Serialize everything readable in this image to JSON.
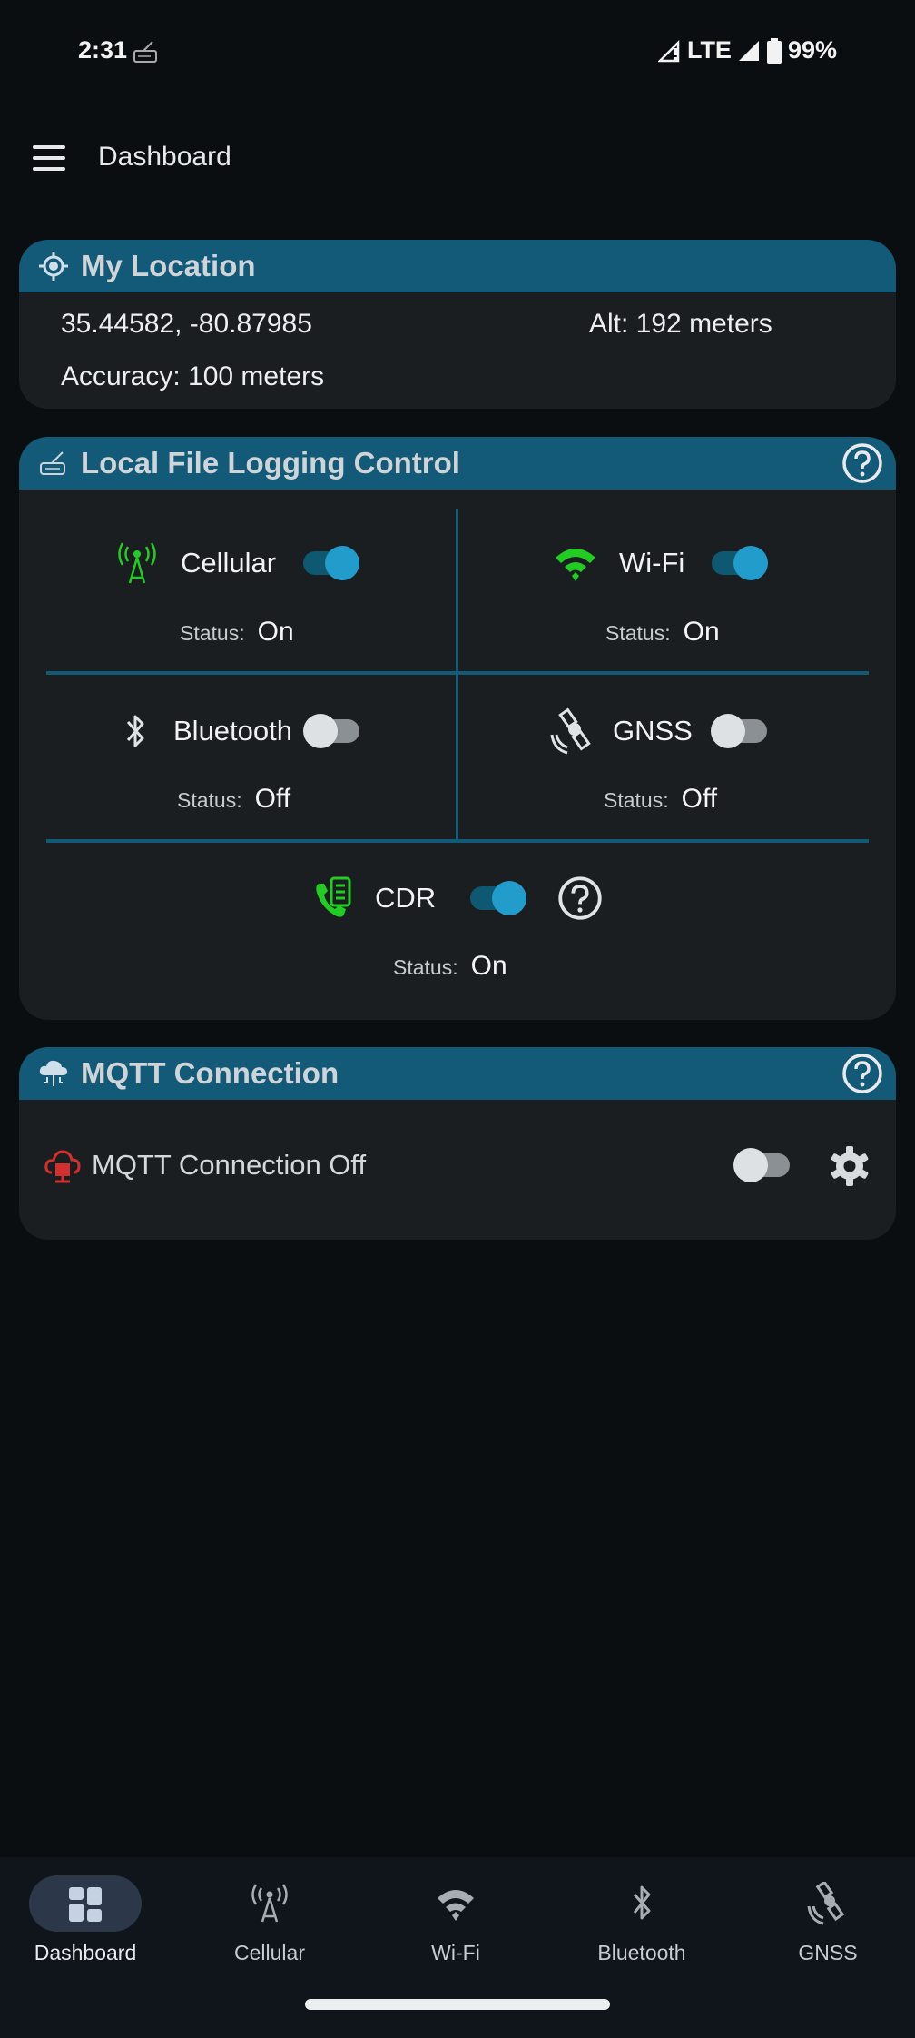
{
  "status_bar": {
    "time": "2:31",
    "network": "LTE",
    "battery": "99%",
    "notification_icon": "log-icon"
  },
  "app_bar": {
    "title": "Dashboard",
    "menu_icon": "hamburger-menu-icon"
  },
  "colors": {
    "header_blue": "#125a78",
    "card_bg": "#1b1e21",
    "toggle_on": "#219ccb",
    "active_green": "#22cc22",
    "error_red": "#d32f2f"
  },
  "location_card": {
    "title": "My Location",
    "coordinates": "35.44582, -80.87985",
    "altitude": "Alt: 192 meters",
    "accuracy": "Accuracy: 100 meters"
  },
  "logging_card": {
    "title": "Local File Logging Control",
    "status_key": "Status:",
    "items": [
      {
        "label": "Cellular",
        "enabled": true,
        "status": "On",
        "icon": "cell-tower-icon"
      },
      {
        "label": "Wi-Fi",
        "enabled": true,
        "status": "On",
        "icon": "wifi-icon"
      },
      {
        "label": "Bluetooth",
        "enabled": false,
        "status": "Off",
        "icon": "bluetooth-icon"
      },
      {
        "label": "GNSS",
        "enabled": false,
        "status": "Off",
        "icon": "satellite-icon"
      },
      {
        "label": "CDR",
        "enabled": true,
        "status": "On",
        "icon": "call-log-icon"
      }
    ]
  },
  "mqtt_card": {
    "title": "MQTT Connection",
    "status_label": "MQTT Connection Off",
    "enabled": false
  },
  "bottom_nav": {
    "items": [
      {
        "label": "Dashboard",
        "active": true
      },
      {
        "label": "Cellular",
        "active": false
      },
      {
        "label": "Wi-Fi",
        "active": false
      },
      {
        "label": "Bluetooth",
        "active": false
      },
      {
        "label": "GNSS",
        "active": false
      }
    ]
  }
}
